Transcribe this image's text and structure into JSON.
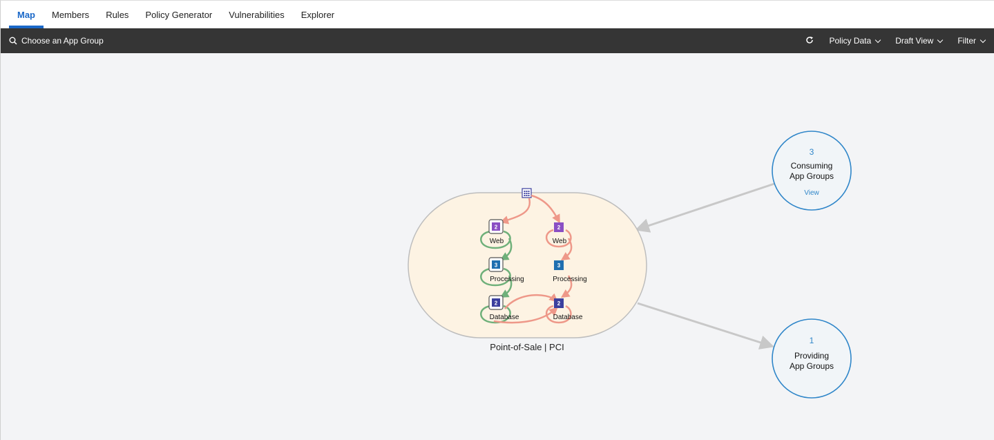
{
  "tabs": [
    {
      "label": "Map",
      "active": true
    },
    {
      "label": "Members",
      "active": false
    },
    {
      "label": "Rules",
      "active": false
    },
    {
      "label": "Policy Generator",
      "active": false
    },
    {
      "label": "Vulnerabilities",
      "active": false
    },
    {
      "label": "Explorer",
      "active": false
    }
  ],
  "toolbar": {
    "search_label": "Choose an App Group",
    "refresh_icon": "refresh-icon",
    "policy_data_label": "Policy Data",
    "draft_view_label": "Draft View",
    "filter_label": "Filter"
  },
  "map": {
    "group_label": "Point-of-Sale | PCI",
    "consuming": {
      "count": "3",
      "line1": "Consuming",
      "line2": "App Groups",
      "link": "View"
    },
    "providing": {
      "count": "1",
      "line1": "Providing",
      "line2": "App Groups"
    },
    "left_column": [
      {
        "count": "2",
        "label": "Web"
      },
      {
        "count": "3",
        "label": "Processing"
      },
      {
        "count": "2",
        "label": "Database"
      }
    ],
    "right_column": [
      {
        "count": "2",
        "label": "Web"
      },
      {
        "count": "3",
        "label": "Processing"
      },
      {
        "count": "2",
        "label": "Database"
      }
    ],
    "colors": {
      "web": "#8a4fc4",
      "processing": "#1f6fb0",
      "database": "#3b3f9e",
      "allowed": "#6fb07a",
      "blocked": "#ee9889",
      "group_fill": "#fdf3e3",
      "circle_stroke": "#2f86c9",
      "circle_fill": "#f1f5f8"
    }
  }
}
